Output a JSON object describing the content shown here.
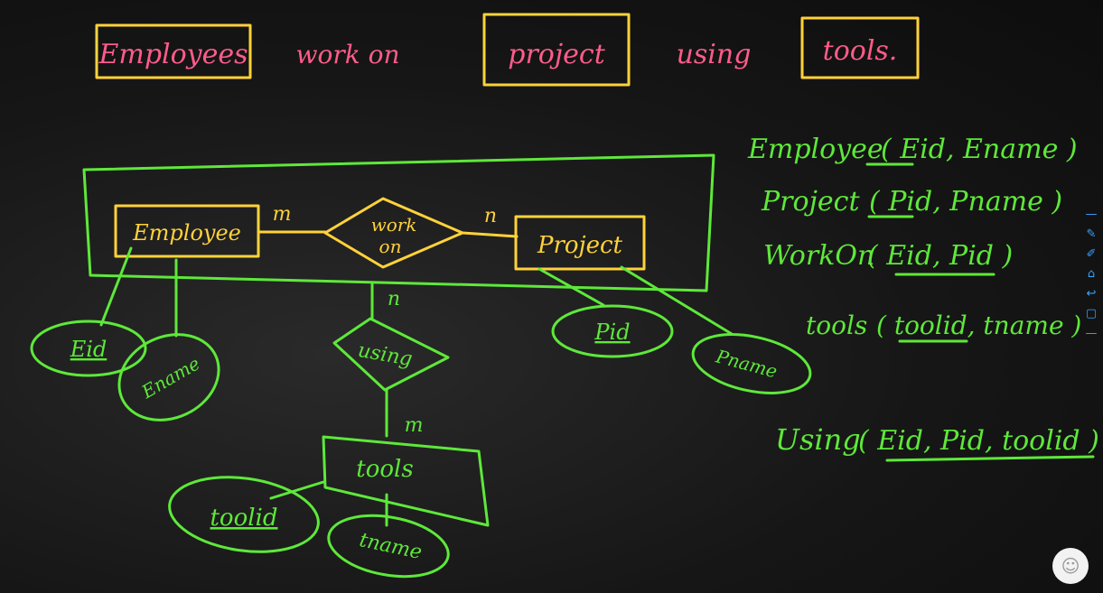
{
  "heading": {
    "employees": "Employees",
    "work_on": "work on",
    "project": "project",
    "using": "using",
    "tools": "tools."
  },
  "er": {
    "entity_employee": "Employee",
    "entity_project": "Project",
    "entity_tools": "tools",
    "rel_work_on_line1": "work",
    "rel_work_on_line2": "on",
    "rel_using": "using",
    "card_employee": "m",
    "card_project": "n",
    "card_work_down": "n",
    "card_tools": "m",
    "attr_eid": "Eid",
    "attr_ename": "Ename",
    "attr_pid": "Pid",
    "attr_pname": "Pname",
    "attr_toolid": "toolid",
    "attr_tname": "tname"
  },
  "schema": {
    "employee_label": "Employee",
    "employee_fields": "( Eid, Ename )",
    "project_label": "Project",
    "project_fields": "( Pid, Pname )",
    "workon_label": "WorkOn",
    "workon_fields": "( Eid, Pid )",
    "tools_label": "tools",
    "tools_fields": "( toolid, tname )",
    "using_label": "Using",
    "using_fields": "( Eid, Pid, toolid )"
  },
  "toolbar": {
    "icons": [
      "minus-icon",
      "edit-icon",
      "pen-icon",
      "home-icon",
      "undo-icon",
      "window-icon",
      "minus-icon"
    ],
    "glyphs": [
      "—",
      "✎",
      "✐",
      "⌂",
      "↩",
      "▢",
      "—"
    ]
  },
  "colors": {
    "heading_text": "#ff5c8a",
    "highlight": "#ffd23a",
    "diagram": "#5ee83a",
    "toolbar": "#3aa0ff"
  }
}
